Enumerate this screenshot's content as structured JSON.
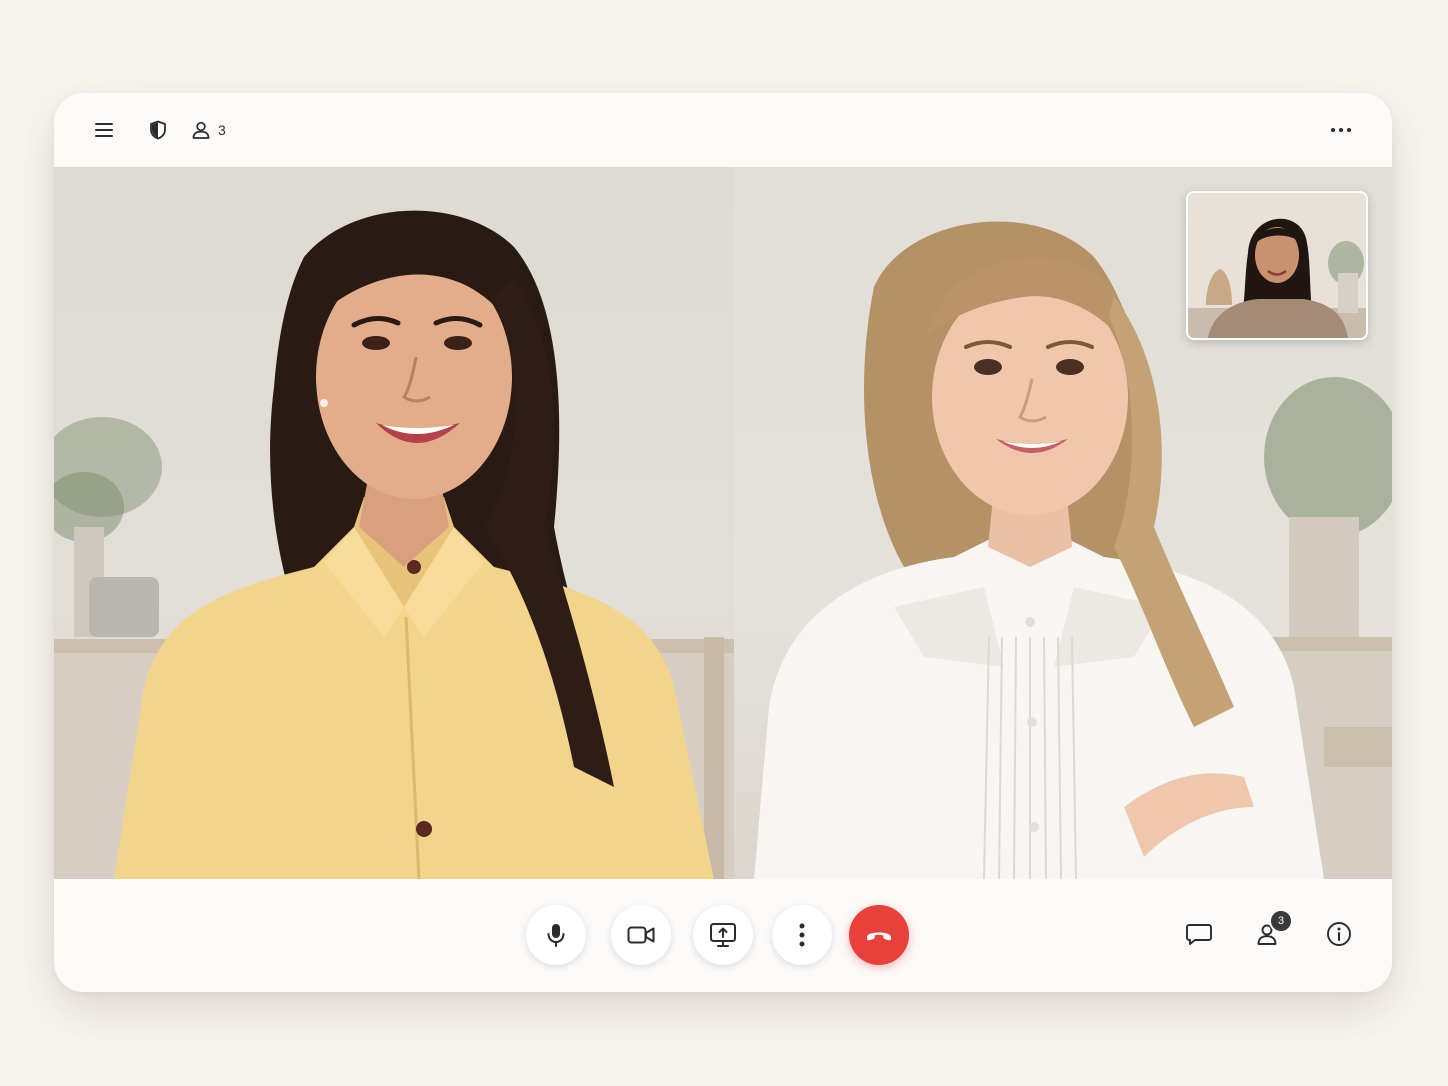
{
  "topbar": {
    "menu_icon": "hamburger-menu-icon",
    "shield_icon": "shield-icon",
    "participants_icon": "person-icon",
    "participants_count": "3",
    "more_icon": "more-horizontal-icon"
  },
  "controls": {
    "mic_icon": "microphone-icon",
    "camera_icon": "video-camera-icon",
    "share_icon": "present-screen-icon",
    "more_icon": "more-vertical-icon",
    "end_icon": "end-call-icon",
    "chat_icon": "chat-icon",
    "people_icon": "people-icon",
    "people_badge": "3",
    "info_icon": "info-icon"
  },
  "colors": {
    "end_call": "#e8403a",
    "window_bg": "#fcfbfa",
    "page_bg": "#f8f4ef"
  }
}
